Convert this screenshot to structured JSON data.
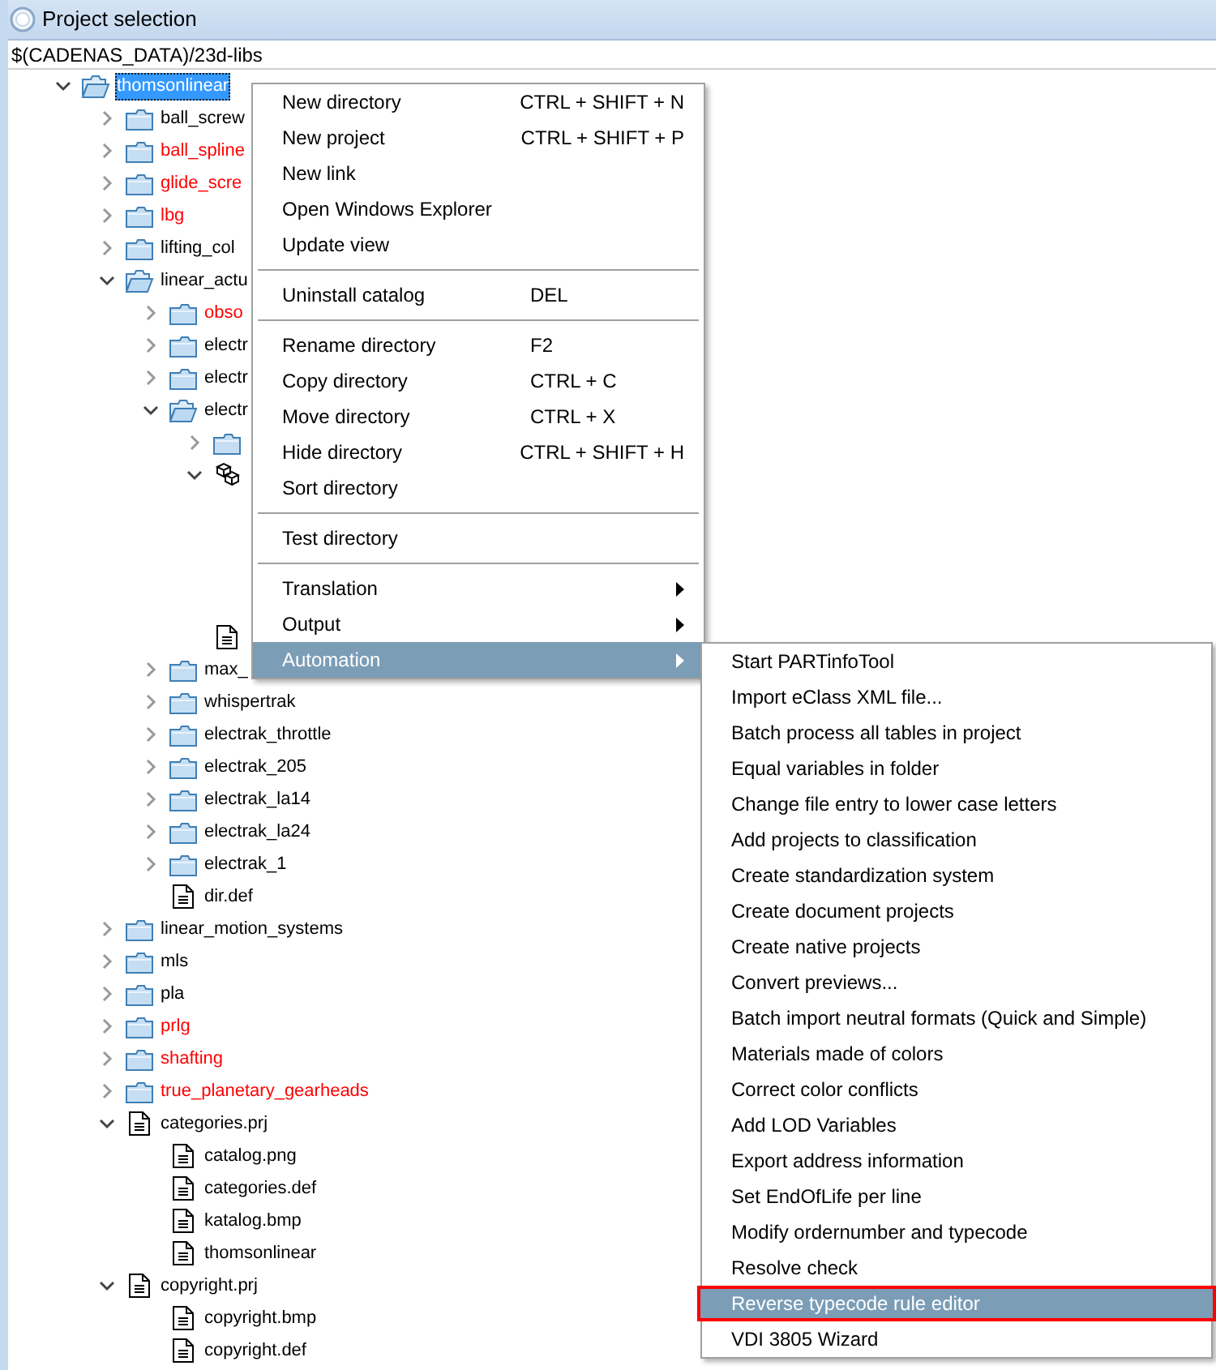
{
  "window": {
    "title": "Project selection"
  },
  "path_field": {
    "value": "$(CADENAS_DATA)/23d-libs"
  },
  "tree": [
    {
      "label": "thomsonlinear",
      "kind": "folder",
      "expanded": true,
      "selected": true,
      "children": [
        {
          "label": "ball_screw",
          "kind": "folder",
          "expanded": false,
          "selected": false
        },
        {
          "label": "ball_spline",
          "kind": "folder",
          "expanded": false,
          "selected": false,
          "color": "#ff0000"
        },
        {
          "label": "glide_scre",
          "kind": "folder",
          "expanded": false,
          "selected": false,
          "color": "#ff0000"
        },
        {
          "label": "lbg",
          "kind": "folder",
          "expanded": false,
          "selected": false,
          "color": "#ff0000"
        },
        {
          "label": "lifting_col",
          "kind": "folder",
          "expanded": false,
          "selected": false
        },
        {
          "label": "linear_actu",
          "kind": "folder",
          "expanded": true,
          "selected": false,
          "children": [
            {
              "label": "obso",
              "kind": "folder",
              "expanded": false,
              "selected": false,
              "color": "#ff0000"
            },
            {
              "label": "electr",
              "kind": "folder",
              "expanded": false,
              "selected": false
            },
            {
              "label": "electr",
              "kind": "folder",
              "expanded": false,
              "selected": false
            },
            {
              "label": "electr",
              "kind": "folder",
              "expanded": true,
              "selected": false,
              "children": [
                {
                  "kind": "folder",
                  "expanded": false
                },
                {
                  "kind": "package",
                  "expanded": true
                },
                {
                  "kind": "file"
                }
              ]
            },
            {
              "label": "max_",
              "kind": "folder",
              "expanded": false,
              "selected": false
            },
            {
              "label": "whispertrak",
              "kind": "folder",
              "expanded": false,
              "selected": false
            },
            {
              "label": "electrak_throttle",
              "kind": "folder",
              "expanded": false,
              "selected": false
            },
            {
              "label": "electrak_205",
              "kind": "folder",
              "expanded": false,
              "selected": false
            },
            {
              "label": "electrak_la14",
              "kind": "folder",
              "expanded": false,
              "selected": false
            },
            {
              "label": "electrak_la24",
              "kind": "folder",
              "expanded": false,
              "selected": false
            },
            {
              "label": "electrak_1",
              "kind": "folder",
              "expanded": false,
              "selected": false
            },
            {
              "label": "dir.def",
              "kind": "file",
              "selected": false
            }
          ]
        },
        {
          "label": "linear_motion_systems",
          "kind": "folder",
          "expanded": false,
          "selected": false
        },
        {
          "label": "mls",
          "kind": "folder",
          "expanded": false,
          "selected": false
        },
        {
          "label": "pla",
          "kind": "folder",
          "expanded": false,
          "selected": false
        },
        {
          "label": "prlg",
          "kind": "folder",
          "expanded": false,
          "selected": false,
          "color": "#ff0000"
        },
        {
          "label": "shafting",
          "kind": "folder",
          "expanded": false,
          "selected": false,
          "color": "#ff0000"
        },
        {
          "label": "true_planetary_gearheads",
          "kind": "folder",
          "expanded": false,
          "selected": false,
          "color": "#ff0000"
        },
        {
          "label": "categories.prj",
          "kind": "file",
          "expanded": true,
          "selected": false,
          "children": [
            {
              "label": "catalog.png",
              "kind": "file",
              "selected": false
            },
            {
              "label": "categories.def",
              "kind": "file",
              "selected": false
            },
            {
              "label": "katalog.bmp",
              "kind": "file",
              "selected": false
            },
            {
              "label": "thomsonlinear",
              "kind": "file",
              "selected": false
            }
          ]
        },
        {
          "label": "copyright.prj",
          "kind": "file",
          "expanded": true,
          "selected": false,
          "children": [
            {
              "label": "copyright.bmp",
              "kind": "file",
              "selected": false
            },
            {
              "label": "copyright.def",
              "kind": "file",
              "selected": false
            }
          ]
        }
      ]
    }
  ],
  "context_menu": [
    {
      "kind": "item",
      "label": "New directory",
      "shortcut": "CTRL + SHIFT + N",
      "selected": false
    },
    {
      "kind": "item",
      "label": "New project",
      "shortcut": "CTRL + SHIFT + P",
      "selected": false
    },
    {
      "kind": "item",
      "label": "New link",
      "selected": false
    },
    {
      "kind": "item",
      "label": "Open Windows Explorer",
      "selected": false
    },
    {
      "kind": "item",
      "label": "Update view",
      "selected": false
    },
    {
      "kind": "separator"
    },
    {
      "kind": "item",
      "label": "Uninstall catalog",
      "shortcut": "DEL",
      "selected": false
    },
    {
      "kind": "separator"
    },
    {
      "kind": "item",
      "label": "Rename directory",
      "shortcut": "F2",
      "selected": false
    },
    {
      "kind": "item",
      "label": "Copy directory",
      "shortcut": "CTRL + C",
      "selected": false
    },
    {
      "kind": "item",
      "label": "Move directory",
      "shortcut": "CTRL + X",
      "selected": false
    },
    {
      "kind": "item",
      "label": "Hide directory",
      "shortcut": "CTRL + SHIFT + H",
      "selected": false
    },
    {
      "kind": "item",
      "label": "Sort directory",
      "selected": false
    },
    {
      "kind": "separator"
    },
    {
      "kind": "item",
      "label": "Test directory",
      "selected": false
    },
    {
      "kind": "separator"
    },
    {
      "kind": "submenu",
      "label": "Translation",
      "selected": false
    },
    {
      "kind": "submenu",
      "label": "Output",
      "selected": false
    },
    {
      "kind": "submenu",
      "label": "Automation",
      "selected": true
    }
  ],
  "submenu": [
    {
      "label": "Start PARTinfoTool",
      "selected": false
    },
    {
      "label": "Import eClass XML file...",
      "selected": false
    },
    {
      "label": "Batch process all tables in project",
      "selected": false
    },
    {
      "label": "Equal variables in folder",
      "selected": false
    },
    {
      "label": "Change file entry to lower case letters",
      "selected": false
    },
    {
      "label": "Add projects to classification",
      "selected": false
    },
    {
      "label": "Create standardization system",
      "selected": false
    },
    {
      "label": "Create document projects",
      "selected": false
    },
    {
      "label": "Create native projects",
      "selected": false
    },
    {
      "label": "Convert previews...",
      "selected": false
    },
    {
      "label": "Batch import neutral formats (Quick and Simple)",
      "selected": false
    },
    {
      "label": "Materials made of colors",
      "selected": false
    },
    {
      "label": "Correct color conflicts",
      "selected": false
    },
    {
      "label": "Add LOD Variables",
      "selected": false
    },
    {
      "label": "Export address information",
      "selected": false
    },
    {
      "label": "Set EndOfLife per line",
      "selected": false
    },
    {
      "label": "Modify ordernumber and typecode",
      "selected": false
    },
    {
      "label": "Resolve check",
      "selected": false
    },
    {
      "label": "Reverse typecode rule editor",
      "selected": true,
      "outlined": true
    },
    {
      "label": "VDI 3805 Wizard",
      "selected": false
    }
  ]
}
